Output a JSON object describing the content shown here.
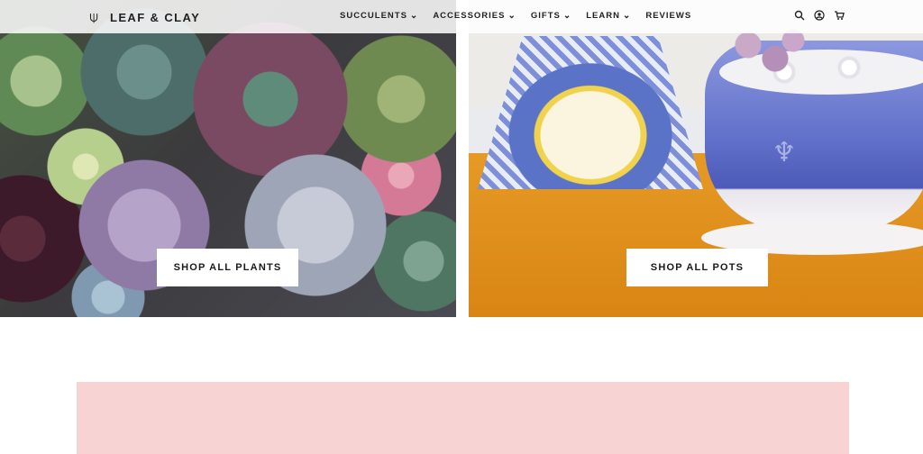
{
  "header": {
    "brand": "LEAF & CLAY",
    "nav": [
      {
        "label": "SUCCULENTS",
        "dropdown": true
      },
      {
        "label": "ACCESSORIES",
        "dropdown": true
      },
      {
        "label": "GIFTS",
        "dropdown": true
      },
      {
        "label": "LEARN",
        "dropdown": true
      },
      {
        "label": "REVIEWS",
        "dropdown": false
      }
    ],
    "icons": [
      "search-icon",
      "account-icon",
      "cart-icon"
    ]
  },
  "hero": {
    "plants_cta": "SHOP ALL PLANTS",
    "pots_cta": "SHOP ALL POTS"
  },
  "colors": {
    "promo_bg": "#f8d3d3",
    "header_bg": "#ffffff",
    "text": "#222222"
  }
}
